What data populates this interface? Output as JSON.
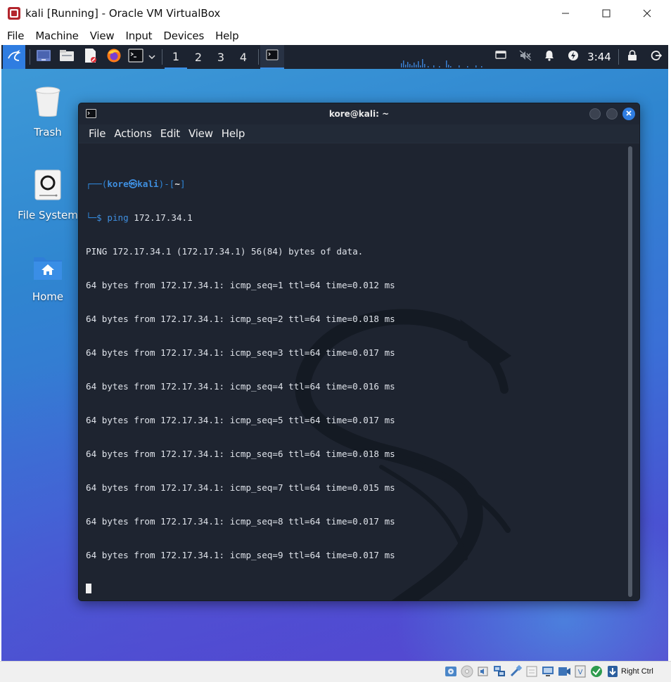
{
  "window": {
    "title": "kali [Running] - Oracle VM VirtualBox",
    "app_icon": "virtualbox-icon"
  },
  "vbox_menu": [
    "File",
    "Machine",
    "View",
    "Input",
    "Devices",
    "Help"
  ],
  "guest_panel": {
    "workspaces": [
      "1",
      "2",
      "3",
      "4"
    ],
    "active_workspace": "1",
    "clock": "3:44"
  },
  "desktop_icons": [
    {
      "label": "Trash",
      "icon": "trash-icon"
    },
    {
      "label": "File System",
      "icon": "drive-icon"
    },
    {
      "label": "Home",
      "icon": "home-folder-icon"
    }
  ],
  "terminal": {
    "title": "kore@kali: ~",
    "menu": [
      "File",
      "Actions",
      "Edit",
      "View",
      "Help"
    ],
    "prompt": {
      "box_open": "┌──(",
      "user": "kore",
      "at": "㉿",
      "host": "kali",
      "box_mid": ")-[",
      "cwd": "~",
      "box_close": "]",
      "box_bottom": "└─",
      "dollar": "$",
      "command": "ping",
      "argument": "172.17.34.1"
    },
    "output": [
      "PING 172.17.34.1 (172.17.34.1) 56(84) bytes of data.",
      "64 bytes from 172.17.34.1: icmp_seq=1 ttl=64 time=0.012 ms",
      "64 bytes from 172.17.34.1: icmp_seq=2 ttl=64 time=0.018 ms",
      "64 bytes from 172.17.34.1: icmp_seq=3 ttl=64 time=0.017 ms",
      "64 bytes from 172.17.34.1: icmp_seq=4 ttl=64 time=0.016 ms",
      "64 bytes from 172.17.34.1: icmp_seq=5 ttl=64 time=0.017 ms",
      "64 bytes from 172.17.34.1: icmp_seq=6 ttl=64 time=0.018 ms",
      "64 bytes from 172.17.34.1: icmp_seq=7 ttl=64 time=0.015 ms",
      "64 bytes from 172.17.34.1: icmp_seq=8 ttl=64 time=0.017 ms",
      "64 bytes from 172.17.34.1: icmp_seq=9 ttl=64 time=0.017 ms"
    ]
  },
  "statusbar": {
    "host_key": "Right Ctrl"
  },
  "colors": {
    "accent": "#2f7de1",
    "panel": "#1c2330",
    "terminal_bg": "#1e2430"
  }
}
